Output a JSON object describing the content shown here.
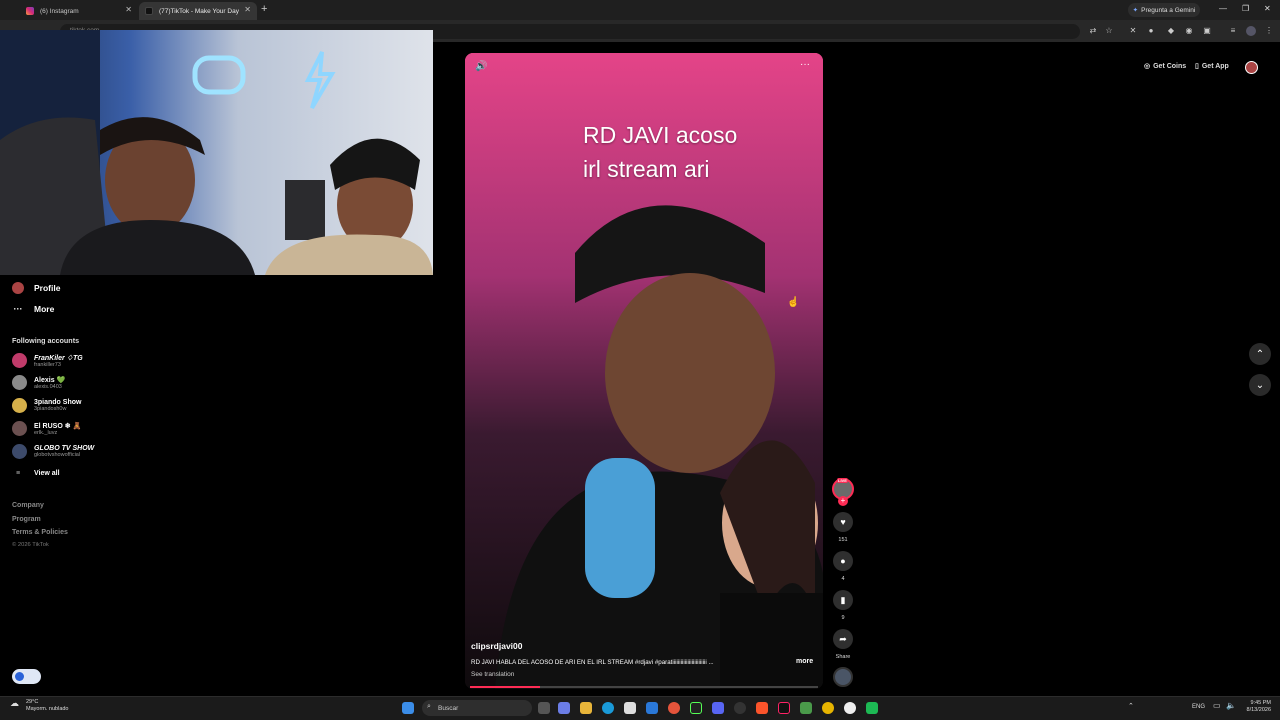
{
  "browser": {
    "tabs": [
      {
        "label": "(6) Instagram"
      },
      {
        "label": "(77)TikTok - Make Your Day"
      }
    ],
    "new_tab_symbol": "+",
    "gemini_label": "Pregunta a Gemini",
    "url_text": "tiktok.com"
  },
  "sidebar": {
    "profile_label": "Profile",
    "more_label": "More",
    "following_title": "Following accounts",
    "accounts": [
      {
        "name": "FranKiler ♢TG",
        "handle": "frankiller73"
      },
      {
        "name": "Alexis 💚",
        "handle": "alexis.0403"
      },
      {
        "name": "3piando Show",
        "handle": "3piandosh0w"
      },
      {
        "name": "El RUSO ❄ 🧸",
        "handle": "erlk._luvz"
      },
      {
        "name": "GLOBO TV SHOW",
        "handle": "globotvshowofficial"
      }
    ],
    "view_all_label": "View all",
    "footer_links": [
      "Company",
      "Program",
      "Terms & Policies"
    ],
    "copyright": "© 2026 TikTok"
  },
  "video": {
    "overlay_line1": "RD JAVI acoso",
    "overlay_line2": "irl stream ari",
    "author": "clipsrdjavi00",
    "caption": "RD JAVI HABLA DEL ACOSO DE ARI EN EL IRL STREAM #rdjavi #paratiiiiiiiiiiiiiiiiiiiiiiiii ...",
    "more_label": "more",
    "see_translation": "See translation",
    "progress_percent": 0.2,
    "likes": "151",
    "comments": "4",
    "saves": "9",
    "share_label": "Share",
    "live_badge": "LIVE"
  },
  "topright": {
    "get_coins": "Get Coins",
    "get_app": "Get App"
  },
  "taskbar": {
    "weather_temp": "29°C",
    "weather_desc": "Mayorm. nublado",
    "search_placeholder": "Buscar",
    "lang": "ENG",
    "time": "9:45 PM",
    "date": "8/13/2026"
  },
  "colors": {
    "accent": "#fe2c55",
    "background": "#000000"
  }
}
